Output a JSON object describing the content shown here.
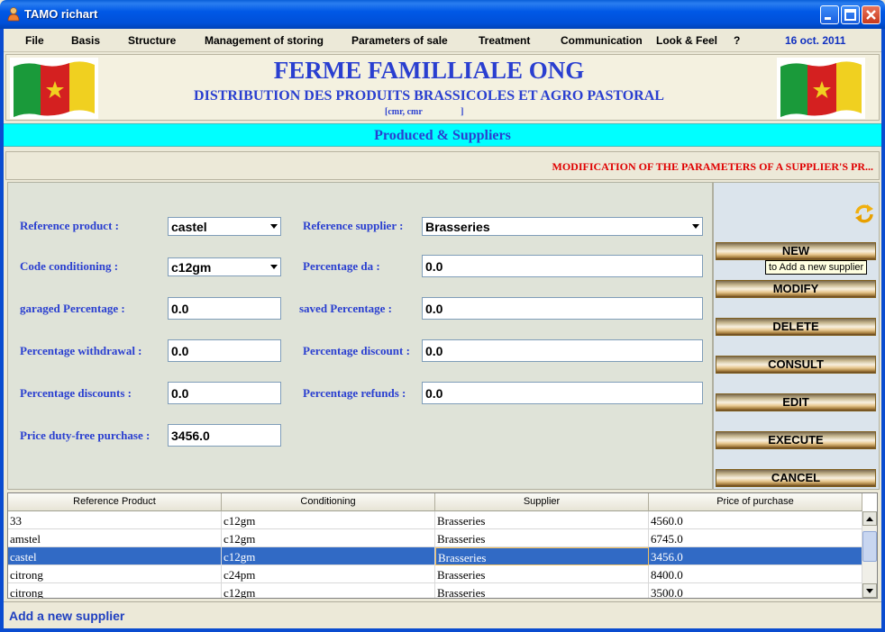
{
  "window": {
    "title": "TAMO richart"
  },
  "menu": {
    "items": [
      "File",
      "Basis",
      "Structure",
      "Management of storing",
      "Parameters of sale",
      "Treatment",
      "Communication",
      "Look & Feel",
      "?"
    ],
    "date": "16 oct. 2011"
  },
  "banner": {
    "title": "FERME FAMILLIALE ONG",
    "subtitle": "DISTRIBUTION DES PRODUITS BRASSICOLES ET AGRO PASTORAL",
    "info": "[cmr, cmr                 ]"
  },
  "section": {
    "title": "Produced & Suppliers"
  },
  "modification": {
    "text": "MODIFICATION OF THE PARAMETERS OF A SUPPLIER'S  PR..."
  },
  "form": {
    "reference_product": {
      "label": "Reference product :",
      "value": "castel"
    },
    "reference_supplier": {
      "label": "Reference supplier :",
      "value": "Brasseries"
    },
    "code_conditioning": {
      "label": "Code conditioning :",
      "value": "c12gm"
    },
    "percentage_da": {
      "label": "Percentage da :",
      "value": "0.0"
    },
    "garaged_percentage": {
      "label": "garaged  Percentage :",
      "value": "0.0"
    },
    "saved_percentage": {
      "label": "saved  Percentage :",
      "value": "0.0"
    },
    "percentage_withdrawal": {
      "label": "Percentage withdrawal :",
      "value": "0.0"
    },
    "percentage_discount": {
      "label": "Percentage discount :",
      "value": "0.0"
    },
    "percentage_discounts": {
      "label": "Percentage discounts :",
      "value": "0.0"
    },
    "percentage_refunds": {
      "label": "Percentage refunds :",
      "value": "0.0"
    },
    "price_duty_free": {
      "label": "Price duty-free  purchase :",
      "value": "3456.0"
    }
  },
  "buttons": {
    "new": "NEW",
    "modify": "MODIFY",
    "delete": "DELETE",
    "consult": "CONSULT",
    "edit": "EDIT",
    "execute": "EXECUTE",
    "cancel": "CANCEL",
    "tooltip": "to  Add a new supplier"
  },
  "table": {
    "headers": [
      "Reference Product",
      "Conditioning",
      "Supplier",
      "Price of purchase"
    ],
    "rows": [
      [
        "33",
        "c12gm",
        "Brasseries",
        "4560.0"
      ],
      [
        "amstel",
        "c12gm",
        "Brasseries",
        "6745.0"
      ],
      [
        "castel",
        "c12gm",
        "Brasseries",
        "3456.0"
      ],
      [
        "citrong",
        "c24pm",
        "Brasseries",
        "8400.0"
      ],
      [
        "citrong",
        "c12gm",
        "Brasseries",
        "3500.0"
      ]
    ],
    "selected_row": 2
  },
  "status": {
    "text": "Add a new supplier"
  },
  "colors": {
    "label_blue": "#2a3fd0",
    "section_cyan": "#00ffff",
    "warning_red": "#e00000",
    "selection": "#316ac5"
  }
}
